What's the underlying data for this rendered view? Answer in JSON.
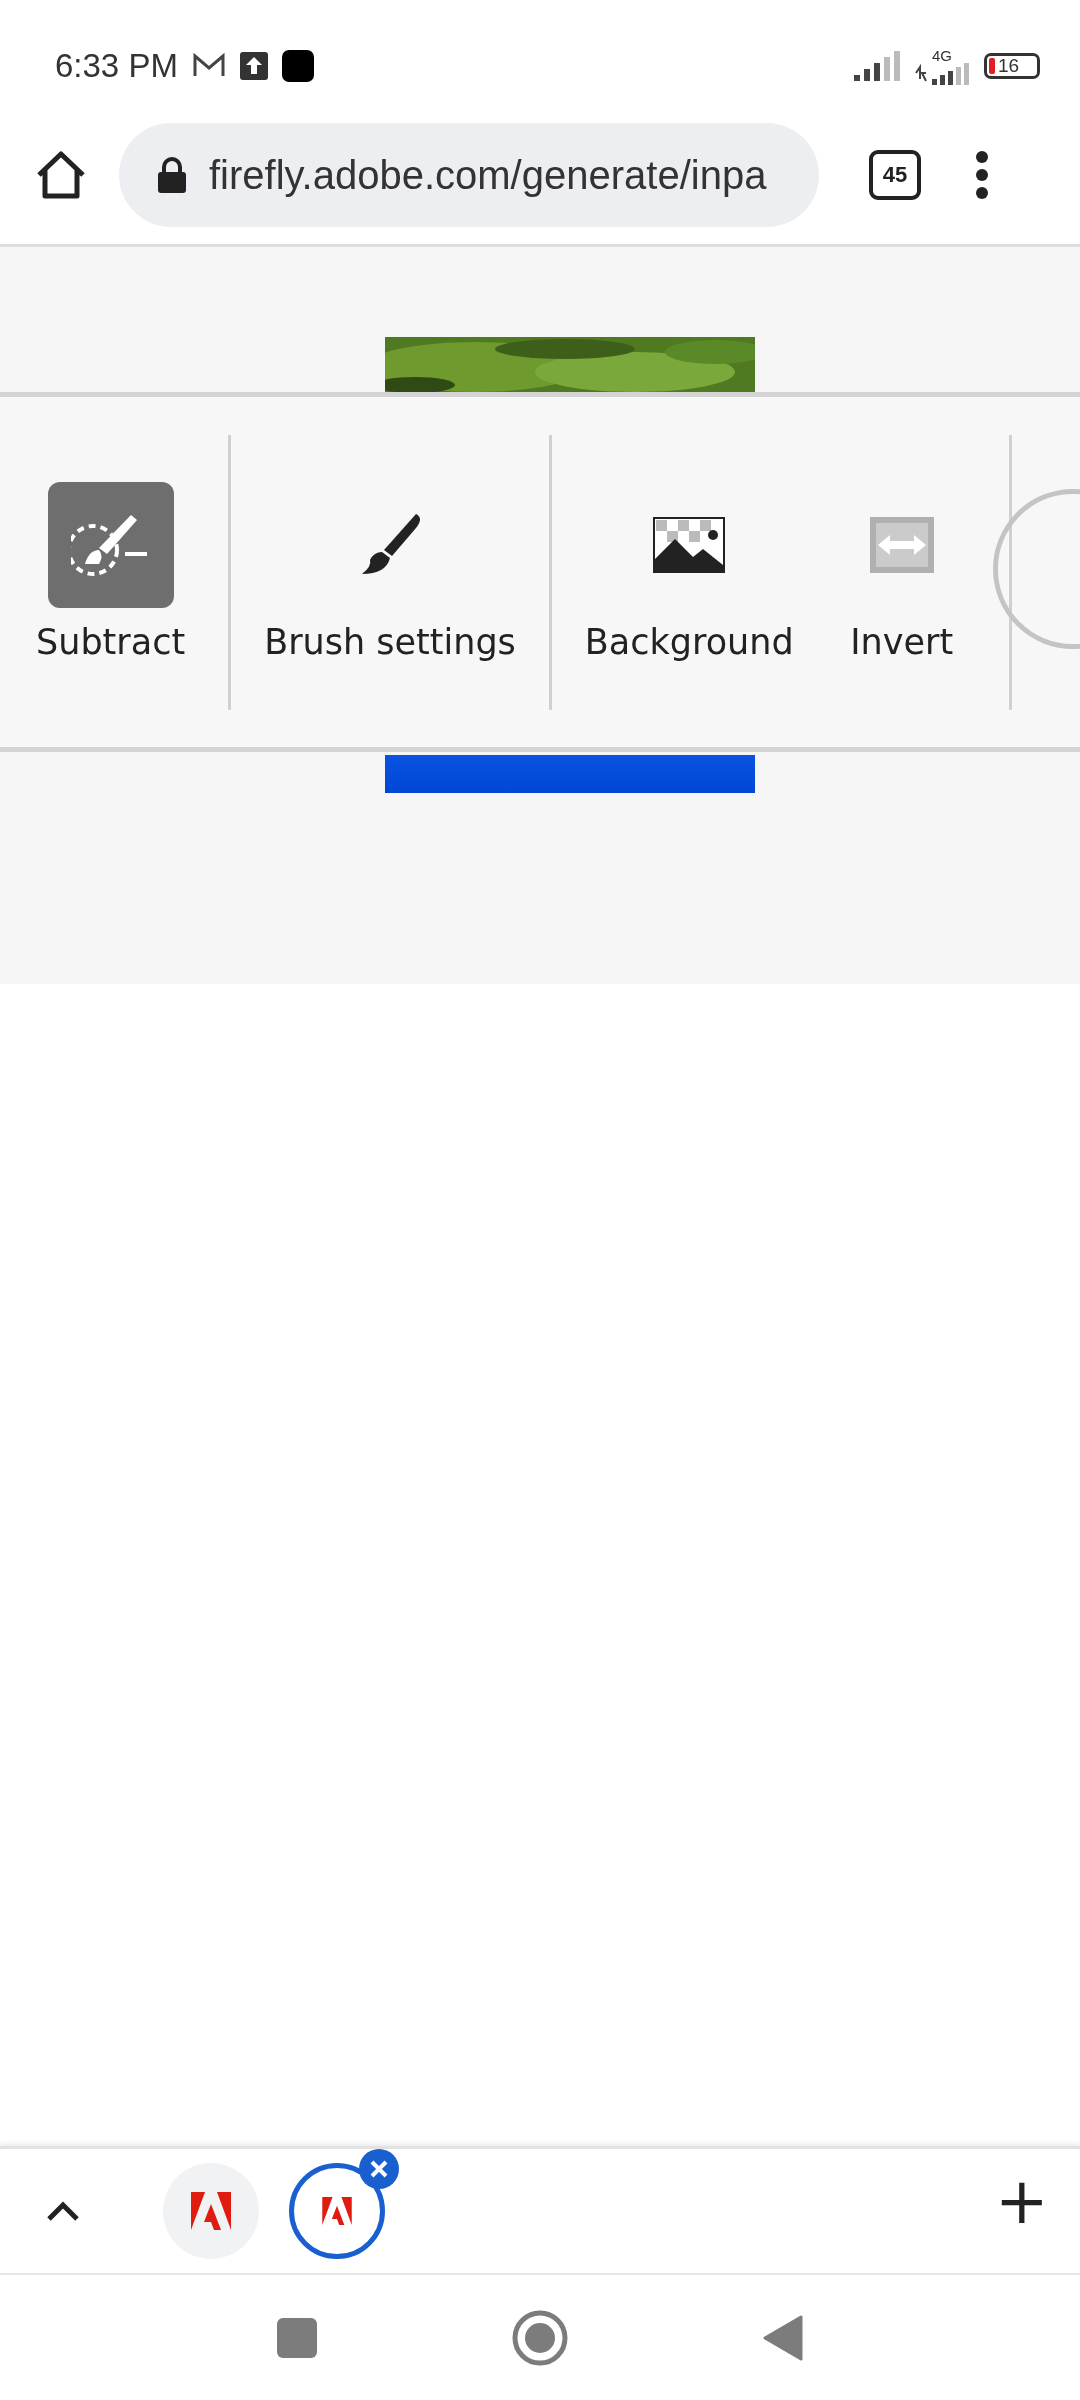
{
  "status_bar": {
    "time": "6:33 PM",
    "network": "4G",
    "battery": "16"
  },
  "browser": {
    "url": "firefly.adobe.com/generate/inpa",
    "tab_count": "45"
  },
  "tools": [
    {
      "kind": "subtract",
      "label": "Subtract",
      "selected": true,
      "disabled": false
    },
    {
      "kind": "brush",
      "label": "Brush settings",
      "selected": false,
      "disabled": false
    },
    {
      "kind": "background",
      "label": "Background",
      "selected": false,
      "disabled": false
    },
    {
      "kind": "invert",
      "label": "Invert",
      "selected": false,
      "disabled": true
    }
  ],
  "tab_strip": {
    "tabs": [
      {
        "selected": false
      },
      {
        "selected": true
      }
    ],
    "new_tab": "+"
  }
}
